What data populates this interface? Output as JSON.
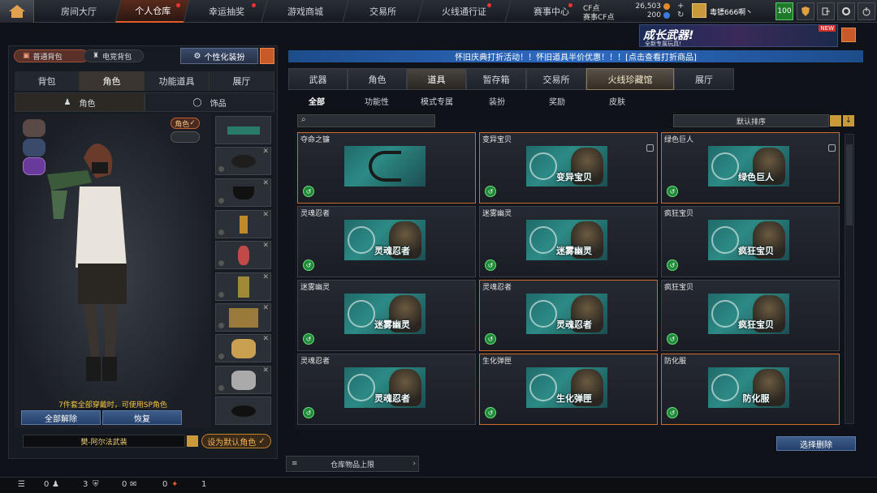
{
  "nav": {
    "tabs": [
      "房间大厅",
      "个人仓库",
      "幸运抽奖",
      "游戏商城",
      "交易所",
      "火线通行证",
      "赛事中心"
    ],
    "active": "个人仓库"
  },
  "currency": {
    "cf_label": "CF点",
    "cf_value": "26,503",
    "match_label": "赛事CF点",
    "match_value": "200"
  },
  "user": {
    "name": "毒镖666啊丶",
    "level": "100"
  },
  "ad": {
    "title": "成长武器!",
    "subtitle": "全新专属玩具!",
    "badge": "NEW"
  },
  "left": {
    "bag_pills": [
      "普通背包",
      "电竞背包"
    ],
    "custom_btn": "个性化装扮",
    "tabs": [
      "背包",
      "角色",
      "功能道具",
      "展厅"
    ],
    "active_tab": "角色",
    "subtabs": [
      "角色",
      "饰品"
    ],
    "badge_role": "角色",
    "hint": "7件套全部穿戴时，可使用SP角色",
    "btn_remove_all": "全部解除",
    "btn_restore": "恢复",
    "character_name": "樊-阿尔法武装",
    "default_btn": "设为默认角色"
  },
  "banner": "怀旧庆典打折活动！！怀旧道具半价优惠！！！[点击查看打折商品]",
  "right": {
    "tabs": [
      "武器",
      "角色",
      "道具",
      "暂存箱",
      "交易所",
      "火线珍藏馆",
      "展厅"
    ],
    "active": "道具",
    "treasure": "火线珍藏馆",
    "filters": [
      "全部",
      "功能性",
      "模式专属",
      "装扮",
      "奖励",
      "皮肤"
    ],
    "active_filter": "全部",
    "search_placeholder": "",
    "sort": "默认排序",
    "items": [
      {
        "name": "夺命之镰",
        "label": "",
        "sel": true,
        "lock": false
      },
      {
        "name": "变异宝贝",
        "label": "变异宝贝",
        "sel": true,
        "lock": true
      },
      {
        "name": "绿色巨人",
        "label": "绿色巨人",
        "sel": true,
        "lock": true
      },
      {
        "name": "灵魂忍者",
        "label": "灵魂忍者",
        "sel": false,
        "lock": false
      },
      {
        "name": "迷雾幽灵",
        "label": "迷雾幽灵",
        "sel": false,
        "lock": false
      },
      {
        "name": "疯狂宝贝",
        "label": "疯狂宝贝",
        "sel": false,
        "lock": false
      },
      {
        "name": "迷雾幽灵",
        "label": "迷雾幽灵",
        "sel": false,
        "lock": false
      },
      {
        "name": "灵魂忍者",
        "label": "灵魂忍者",
        "sel": true,
        "lock": false
      },
      {
        "name": "疯狂宝贝",
        "label": "疯狂宝贝",
        "sel": false,
        "lock": false
      },
      {
        "name": "灵魂忍者",
        "label": "灵魂忍者",
        "sel": false,
        "lock": false
      },
      {
        "name": "生化弹匣",
        "label": "生化弹匣",
        "sel": true,
        "lock": false
      },
      {
        "name": "防化服",
        "label": "防化服",
        "sel": true,
        "lock": false
      }
    ],
    "delete_btn": "选择删除",
    "storage_label": "仓库物品上限"
  },
  "bottom": {
    "counts": [
      "0",
      "3",
      "0",
      "0",
      "1"
    ]
  }
}
